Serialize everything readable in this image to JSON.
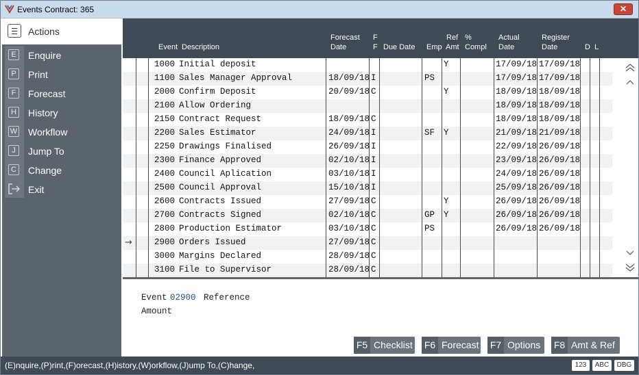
{
  "window": {
    "title": "Events  Contract: 365",
    "close_label": "✕"
  },
  "sidebar": {
    "header": "Actions",
    "items": [
      {
        "key": "E",
        "label": "Enquire"
      },
      {
        "key": "P",
        "label": "Print"
      },
      {
        "key": "F",
        "label": "Forecast"
      },
      {
        "key": "H",
        "label": "History"
      },
      {
        "key": "W",
        "label": "Workflow"
      },
      {
        "key": "J",
        "label": "Jump To"
      },
      {
        "key": "C",
        "label": "Change"
      },
      {
        "key": "",
        "label": "Exit"
      }
    ]
  },
  "grid": {
    "headers": {
      "event": "Event",
      "description": "Description",
      "forecast_1": "Forecast",
      "forecast_2": "Date",
      "f_1": "F",
      "f_2": "F",
      "due_date": "Due Date",
      "emp": "Emp",
      "ref_1": "Ref",
      "ref_2": "Amt",
      "pct_1": "%",
      "pct_2": "Compl",
      "actual_1": "Actual",
      "actual_2": "Date",
      "register_1": "Register",
      "register_2": "Date",
      "d": "D",
      "l": "L"
    },
    "current_row_marker": "→",
    "rows": [
      {
        "event": "1000",
        "description": "Initial deposit",
        "forecast": "",
        "f": "",
        "due": "",
        "emp": "",
        "ref": "Y",
        "pct": "",
        "actual": "17/09/18",
        "register": "17/09/18"
      },
      {
        "event": "1100",
        "description": "Sales Manager Approval",
        "forecast": "18/09/18",
        "f": "I",
        "due": "",
        "emp": "PS",
        "ref": "",
        "pct": "",
        "actual": "17/09/18",
        "register": "17/09/18"
      },
      {
        "event": "2000",
        "description": "Confirm Deposit",
        "forecast": "20/09/18",
        "f": "C",
        "due": "",
        "emp": "",
        "ref": "Y",
        "pct": "",
        "actual": "18/09/18",
        "register": "18/09/18"
      },
      {
        "event": "2100",
        "description": "Allow Ordering",
        "forecast": "",
        "f": "",
        "due": "",
        "emp": "",
        "ref": "",
        "pct": "",
        "actual": "18/09/18",
        "register": "18/09/18"
      },
      {
        "event": "2150",
        "description": "Contract Request",
        "forecast": "18/09/18",
        "f": "C",
        "due": "",
        "emp": "",
        "ref": "",
        "pct": "",
        "actual": "18/09/18",
        "register": "18/09/18"
      },
      {
        "event": "2200",
        "description": "Sales Estimator",
        "forecast": "24/09/18",
        "f": "I",
        "due": "",
        "emp": "SF",
        "ref": "Y",
        "pct": "",
        "actual": "21/09/18",
        "register": "21/09/18"
      },
      {
        "event": "2250",
        "description": "Drawings Finalised",
        "forecast": "26/09/18",
        "f": "I",
        "due": "",
        "emp": "",
        "ref": "",
        "pct": "",
        "actual": "22/09/18",
        "register": "26/09/18"
      },
      {
        "event": "2300",
        "description": "Finance Approved",
        "forecast": "02/10/18",
        "f": "I",
        "due": "",
        "emp": "",
        "ref": "",
        "pct": "",
        "actual": "23/09/18",
        "register": "26/09/18"
      },
      {
        "event": "2400",
        "description": "Council Aplication",
        "forecast": "03/10/18",
        "f": "I",
        "due": "",
        "emp": "",
        "ref": "",
        "pct": "",
        "actual": "24/09/18",
        "register": "26/09/18"
      },
      {
        "event": "2500",
        "description": "Council Approval",
        "forecast": "15/10/18",
        "f": "I",
        "due": "",
        "emp": "",
        "ref": "",
        "pct": "",
        "actual": "25/09/18",
        "register": "26/09/18"
      },
      {
        "event": "2600",
        "description": "Contracts Issued",
        "forecast": "27/09/18",
        "f": "C",
        "due": "",
        "emp": "",
        "ref": "Y",
        "pct": "",
        "actual": "26/09/18",
        "register": "26/09/18"
      },
      {
        "event": "2700",
        "description": "Contracts Signed",
        "forecast": "02/10/18",
        "f": "C",
        "due": "",
        "emp": "GP",
        "ref": "Y",
        "pct": "",
        "actual": "26/09/18",
        "register": "26/09/18"
      },
      {
        "event": "2800",
        "description": "Production Estimator",
        "forecast": "03/10/18",
        "f": "C",
        "due": "",
        "emp": "PS",
        "ref": "",
        "pct": "",
        "actual": "26/09/18",
        "register": "26/09/18"
      },
      {
        "event": "2900",
        "description": "Orders Issued",
        "forecast": "27/09/18",
        "f": "C",
        "due": "",
        "emp": "",
        "ref": "",
        "pct": "",
        "actual": "",
        "register": ""
      },
      {
        "event": "3000",
        "description": "Margins Declared",
        "forecast": "28/09/18",
        "f": "C",
        "due": "",
        "emp": "",
        "ref": "",
        "pct": "",
        "actual": "",
        "register": ""
      },
      {
        "event": "3100",
        "description": "File to Supervisor",
        "forecast": "28/09/18",
        "f": "C",
        "due": "",
        "emp": "",
        "ref": "",
        "pct": "",
        "actual": "",
        "register": ""
      }
    ]
  },
  "detail": {
    "event_label": "Event",
    "event_value": "02900",
    "reference_label": "Reference",
    "amount_label": "Amount"
  },
  "function_keys": [
    {
      "key": "F5",
      "label": "Checklist"
    },
    {
      "key": "F6",
      "label": "Forecast"
    },
    {
      "key": "F7",
      "label": "Options"
    },
    {
      "key": "F8",
      "label": "Amt & Ref"
    }
  ],
  "statusbar": {
    "hint": "(E)nquire,(P)rint,(F)orecast,(H)istory,(W)orkflow,(J)ump To,(C)hange,",
    "indicators": [
      "123",
      "ABC",
      "DBG"
    ]
  },
  "colors": {
    "header_bg": "#3f4a55",
    "sidebar_bg": "#5b636c",
    "accent_blue": "#1f4e8c",
    "close_red": "#c8443a"
  }
}
